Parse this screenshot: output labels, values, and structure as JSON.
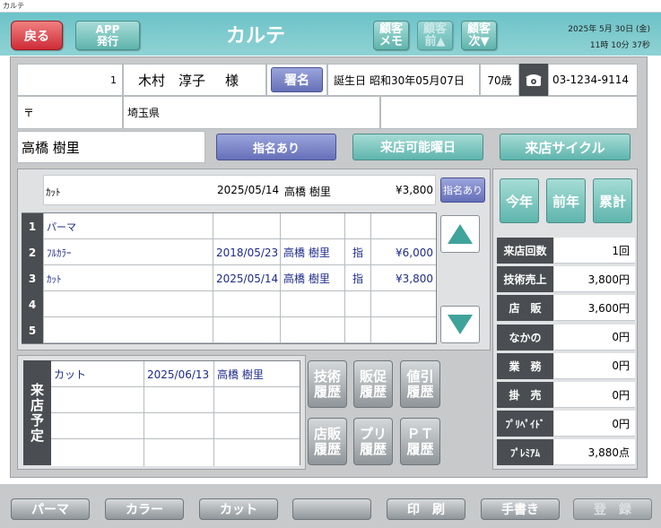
{
  "window": {
    "title": "カルテ"
  },
  "header": {
    "back_label": "戻る",
    "app_label": "APP\n発行",
    "title": "カルテ",
    "memo_label": "顧客\nメモ",
    "prev_label": "顧客\n前▲",
    "next_label": "顧客\n次▼",
    "date": "2025年 5月 30日 (金)",
    "time": "11時 10分 37秒"
  },
  "customer": {
    "number": "1",
    "name": "木村　淳子",
    "honorific": "様",
    "sign_label": "署名",
    "birthday_label": "誕生日",
    "birthday": "昭和30年05月07日",
    "age": "70歳",
    "phone": "03-1234-9114",
    "postal_mark": "〒",
    "address": "埼玉県",
    "staff": "高橋 樹里"
  },
  "buttons": {
    "nominated": "指名あり",
    "visit_days": "来店可能曜日",
    "visit_cycle": "来店サイクル"
  },
  "last_visit": {
    "menu": "ｶｯﾄ",
    "date": "2025/05/14",
    "staff": "高橋 樹里",
    "price": "¥3,800",
    "nominated": "指名あり"
  },
  "history": [
    {
      "num": "1",
      "menu": "パーマ",
      "date": "",
      "staff": "",
      "nom": "",
      "price": ""
    },
    {
      "num": "2",
      "menu": "ﾌﾙｶﾗｰ",
      "date": "2018/05/23",
      "staff": "高橋 樹里",
      "nom": "指",
      "price": "¥6,000"
    },
    {
      "num": "3",
      "menu": "ｶｯﾄ",
      "date": "2025/05/14",
      "staff": "高橋 樹里",
      "nom": "指",
      "price": "¥3,800"
    },
    {
      "num": "4",
      "menu": "",
      "date": "",
      "staff": "",
      "nom": "",
      "price": ""
    },
    {
      "num": "5",
      "menu": "",
      "date": "",
      "staff": "",
      "nom": "",
      "price": ""
    }
  ],
  "reservation": {
    "label": "来店予定",
    "rows": [
      {
        "menu": "カット",
        "date": "2025/06/13",
        "staff": "高橋 樹里"
      },
      {
        "menu": "",
        "date": "",
        "staff": ""
      },
      {
        "menu": "",
        "date": "",
        "staff": ""
      }
    ]
  },
  "history_buttons": {
    "tech": "技術\n履歴",
    "promo": "販促\n履歴",
    "discount": "値引\n履歴",
    "shop_sales": "店販\n履歴",
    "prepaid": "プリ\n履歴",
    "pt": "ＰＴ\n履歴"
  },
  "period_tabs": {
    "this_year": "今年",
    "last_year": "前年",
    "total": "累計"
  },
  "stats": [
    {
      "label": "来店回数",
      "value": "1回"
    },
    {
      "label": "技術売上",
      "value": "3,800円"
    },
    {
      "label": "店　販",
      "value": "3,600円"
    },
    {
      "label": "なかの",
      "value": "0円"
    },
    {
      "label": "業　務",
      "value": "0円"
    },
    {
      "label": "掛　売",
      "value": "0円"
    },
    {
      "label": "ﾌﾟﾘﾍﾟｲﾄﾞ",
      "value": "0円"
    },
    {
      "label": "ﾌﾟﾚﾐｱﾑ",
      "value": "3,880点"
    }
  ],
  "footer": {
    "perm": "パーマ",
    "color": "カラー",
    "cut": "カット",
    "blank": "",
    "print": "印　刷",
    "handwriting": "手書き",
    "register": "登　録"
  },
  "colors": {
    "header_teal": "#7ccacd",
    "back_red": "#d63a44",
    "dark_label": "#4a4d51",
    "value_blue": "#1d2a8a"
  }
}
